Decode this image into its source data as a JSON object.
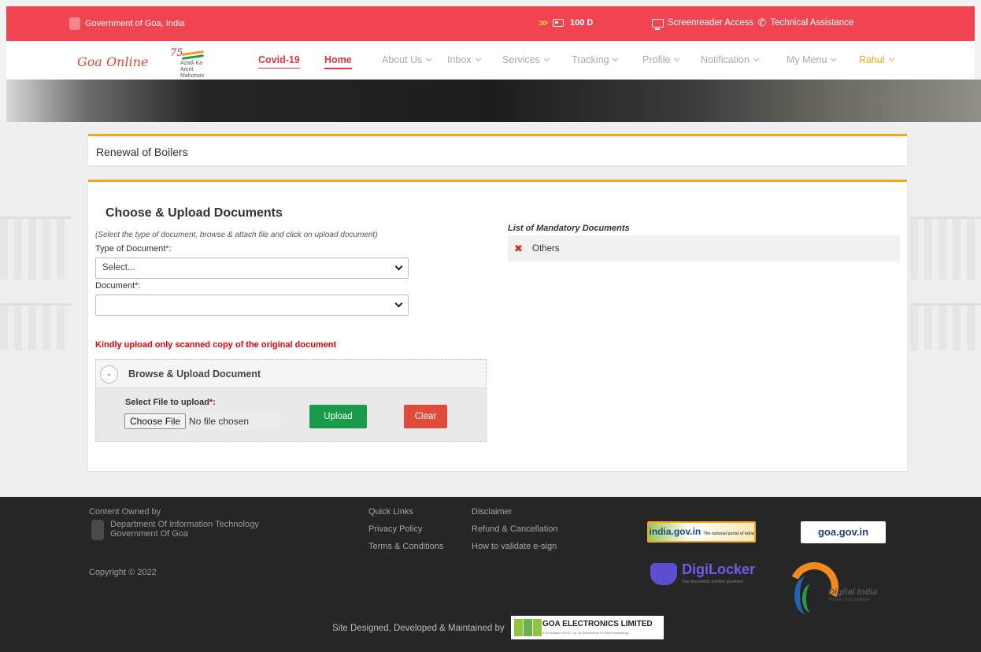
{
  "topbar": {
    "government": "Government of Goa, India",
    "counter": "100 D",
    "screenreader": "Screenreader Access",
    "technical": "Technical Assistance"
  },
  "brand": {
    "logo": "Goa Online",
    "azadi_number": "75",
    "azadi_line1": "Azadi Ka",
    "azadi_line2": "Amrit Mahotsav"
  },
  "nav": {
    "covid": "Covid-19",
    "home": "Home",
    "about": "About Us",
    "inbox": "Inbox",
    "services": "Services",
    "tracking": "Tracking",
    "profile": "Profile",
    "notification": "Notification",
    "mymenu": "My Menu",
    "user": "Rahul"
  },
  "page": {
    "title": "Renewal of Boilers"
  },
  "form": {
    "heading": "Choose & Upload Documents",
    "instruction": "(Select the type of document, browse & attach file and click on upload document)",
    "type_label": "Type of Document",
    "type_value": "Select...",
    "document_label": "Document",
    "document_value": "",
    "required_mark": "*",
    "colon": ":",
    "warning": "Kindly upload only scanned copy of the original document",
    "upload_section": {
      "toggle": "-",
      "title": "Browse & Upload Document",
      "select_label": "Select File to upload",
      "choose_button": "Choose File",
      "no_file": "No file chosen",
      "upload_button": "Upload",
      "clear_button": "Clear"
    }
  },
  "mandatory": {
    "title": "List of Mandatory Documents",
    "items": [
      {
        "status": "missing",
        "name": "Others"
      }
    ]
  },
  "footer": {
    "owned_by": "Content Owned by",
    "dept_line1": "Department Of Information Technology",
    "dept_line2": "Government Of Goa",
    "copyright": "Copyright © 2022",
    "quick_links": "Quick Links",
    "privacy": "Privacy Policy",
    "terms": "Terms & Conditions",
    "disclaimer": "Disclaimer",
    "refund": "Refund & Cancellation",
    "esign": "How to validate e-sign",
    "india_logo": "india.gov.in",
    "india_small": "The national portal of India",
    "goa_logo": "goa.gov.in",
    "digilocker": "DigiLocker",
    "digilocker_tag": "Your documents anytime anywhere",
    "digital_india": "Digital India",
    "digital_india_tag": "Power To Empower",
    "site_credit": "Site Designed, Developed & Maintained by",
    "gel": "GOA ELECTRONICS LIMITED",
    "gel_tag": "A Subsidiary of EDC Ltd. (A Government of Goa Undertaking)"
  },
  "colors": {
    "topbar": "#f14451",
    "accent": "#d73844",
    "card_border": "#f5a623",
    "upload_button": "#1a9b4b",
    "clear_button": "#e04b3c",
    "footer": "#262626"
  },
  "icons": {
    "emblem": "goa-emblem-icon",
    "arrows": "double-chevron-icon",
    "idcard": "id-card-icon",
    "monitor": "monitor-icon",
    "phone": "phone-icon",
    "cross": "cross-icon"
  }
}
